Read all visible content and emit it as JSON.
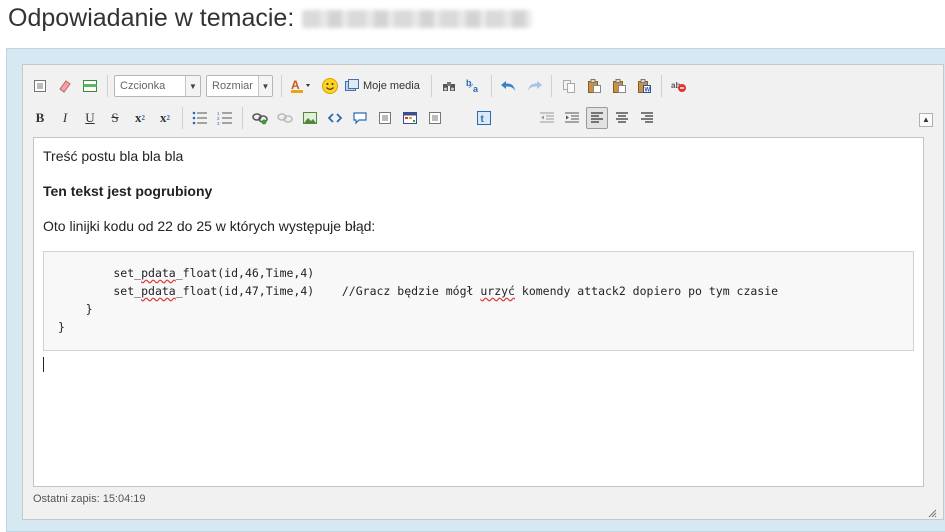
{
  "page": {
    "title": "Odpowiadanie w temacie:"
  },
  "toolbar": {
    "font_combo": "Czcionka",
    "size_combo": "Rozmiar",
    "moje_media": "Moje media",
    "row1_icons": [
      "source-icon",
      "remove-format-icon",
      "template-icon"
    ],
    "row2_icons": [
      "bold-icon",
      "italic-icon",
      "underline-icon",
      "strikethrough-icon",
      "subscript-icon",
      "superscript-icon",
      "bulleted-list-icon",
      "numbered-list-icon",
      "link-icon",
      "unlink-icon",
      "image-icon",
      "code-icon",
      "quote-icon",
      "spoiler-icon",
      "table-icon",
      "hidden-icon",
      "twitter-icon",
      "outdent-icon",
      "indent-icon",
      "align-left-icon",
      "align-center-icon",
      "align-right-icon"
    ]
  },
  "content": {
    "line1": "Treść postu bla bla bla",
    "line2": "Ten tekst jest pogrubiony",
    "line3": "Oto linijki kodu od 22 do 25 w których występuje błąd:",
    "code_lines": [
      "        set_pdata_float(id,46,Time,4)",
      "        set_pdata_float(id,47,Time,4)    //Gracz będzie mógł urzyć komendy attack2 dopiero po tym czasie",
      "    }",
      "}"
    ]
  },
  "status": {
    "last_save": "Ostatni zapis: 15:04:19"
  }
}
